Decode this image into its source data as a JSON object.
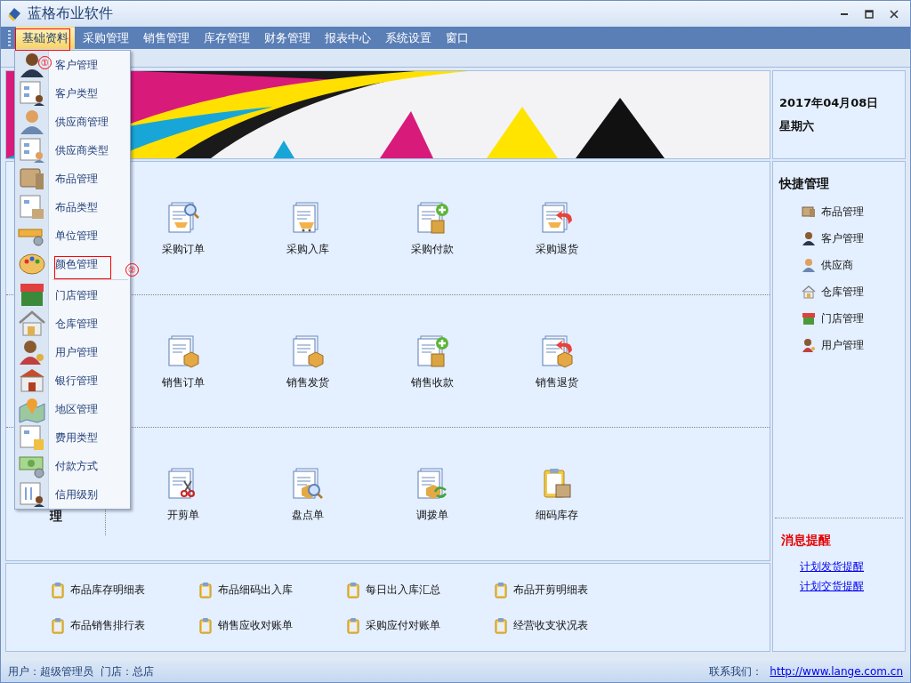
{
  "window": {
    "title": "蓝格布业软件"
  },
  "menu": [
    {
      "label": "基础资料",
      "selected": true
    },
    {
      "label": "采购管理",
      "selected": false
    },
    {
      "label": "销售管理",
      "selected": false
    },
    {
      "label": "库存管理",
      "selected": false
    },
    {
      "label": "财务管理",
      "selected": false
    },
    {
      "label": "报表中心",
      "selected": false
    },
    {
      "label": "系统设置",
      "selected": false
    },
    {
      "label": "窗口",
      "selected": false
    }
  ],
  "dropdown": {
    "groups": [
      [
        "客户管理",
        "客户类型",
        "供应商管理",
        "供应商类型",
        "布品管理",
        "布品类型",
        "单位管理",
        "颜色管理"
      ],
      [
        "门店管理",
        "仓库管理",
        "用户管理",
        "银行管理",
        "地区管理",
        "费用类型",
        "付款方式",
        "信用级别"
      ]
    ]
  },
  "annotations": [
    {
      "kind": "box"
    },
    {
      "kind": "circle",
      "label": "①"
    },
    {
      "kind": "box"
    },
    {
      "kind": "circle",
      "label": "②"
    }
  ],
  "date": {
    "date": "2017年04月08日",
    "weekday": "星期六"
  },
  "sections": [
    {
      "items": [
        "采购订单",
        "采购入库",
        "采购付款",
        "采购退货"
      ]
    },
    {
      "items": [
        "销售订单",
        "销售发货",
        "销售收款",
        "销售退货"
      ]
    },
    {
      "label": "理",
      "items": [
        "开剪单",
        "盘点单",
        "调拨单",
        "细码库存"
      ]
    }
  ],
  "reports": [
    "布品库存明细表",
    "布品细码出入库",
    "每日出入库汇总",
    "布品开剪明细表",
    "布品销售排行表",
    "销售应收对账单",
    "采购应付对账单",
    "经营收支状况表"
  ],
  "quick": {
    "title": "快捷管理",
    "items": [
      "布品管理",
      "客户管理",
      "供应商",
      "仓库管理",
      "门店管理",
      "用户管理"
    ]
  },
  "messages": {
    "title": "消息提醒",
    "links": [
      "计划发货提醒",
      "计划交货提醒"
    ]
  },
  "status_bar": {
    "user": "用户：超级管理员",
    "store": "门店：总店",
    "contact": "联系我们：",
    "url": "http://www.lange.com.cn"
  }
}
